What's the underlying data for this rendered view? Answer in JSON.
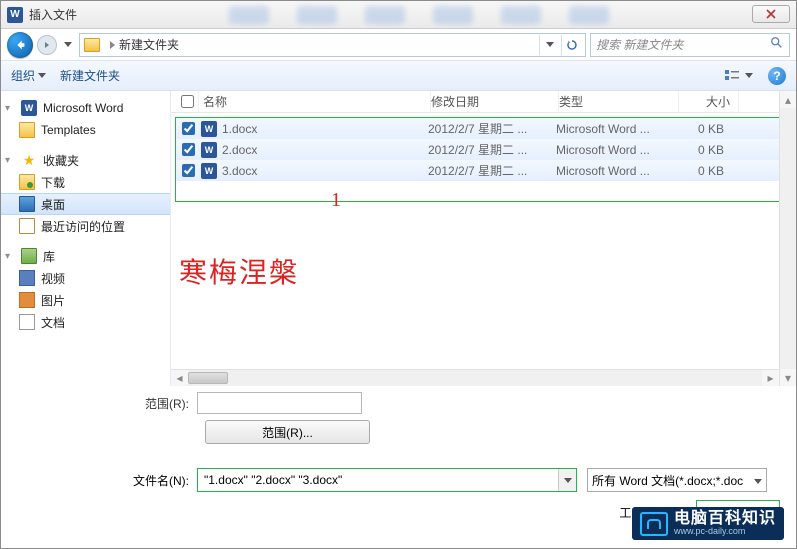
{
  "title": "插入文件",
  "nav": {
    "crumb": "新建文件夹",
    "search_placeholder": "搜索 新建文件夹"
  },
  "toolbar": {
    "organize": "组织",
    "new_folder": "新建文件夹"
  },
  "sidebar": {
    "word": "Microsoft Word",
    "templates": "Templates",
    "favorites": "收藏夹",
    "downloads": "下载",
    "desktop": "桌面",
    "recent": "最近访问的位置",
    "libraries": "库",
    "videos": "视频",
    "pictures": "图片",
    "documents": "文档"
  },
  "columns": {
    "name": "名称",
    "date": "修改日期",
    "type": "类型",
    "size": "大小"
  },
  "files": [
    {
      "name": "1.docx",
      "date": "2012/2/7 星期二 ...",
      "type": "Microsoft Word ...",
      "size": "0 KB"
    },
    {
      "name": "2.docx",
      "date": "2012/2/7 星期二 ...",
      "type": "Microsoft Word ...",
      "size": "0 KB"
    },
    {
      "name": "3.docx",
      "date": "2012/2/7 星期二 ...",
      "type": "Microsoft Word ...",
      "size": "0 KB"
    }
  ],
  "annotations": {
    "marker1": "1",
    "watermark_text": "寒梅涅槃"
  },
  "form": {
    "range_label": "范围(R):",
    "range_button": "范围(R)...",
    "filename_label": "文件名(N):",
    "filename_value": "\"1.docx\" \"2.docx\" \"3.docx\"",
    "filetype": "所有 Word 文档(*.docx;*.doc"
  },
  "footer": {
    "tools": "工具(L)"
  },
  "brand": {
    "cn": "电脑百科知识",
    "en": "www.pc-daily.com"
  }
}
